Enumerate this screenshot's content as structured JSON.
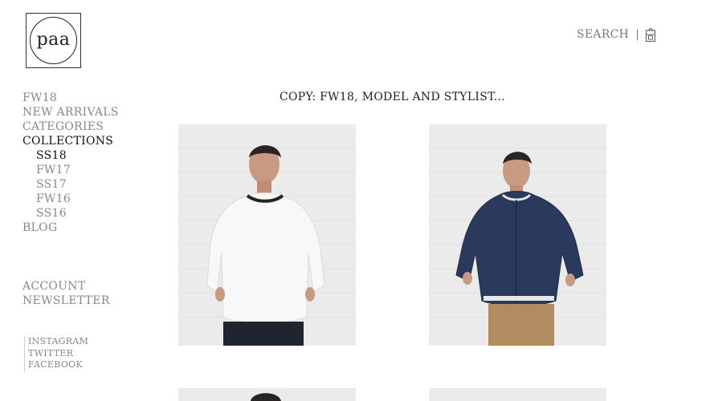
{
  "logo": {
    "text": "paa"
  },
  "header": {
    "search_label": "SEARCH",
    "separator": "|",
    "bag_icon": "shopping-bag-icon"
  },
  "nav": {
    "items": [
      {
        "label": "FW18"
      },
      {
        "label": "NEW ARRIVALS"
      },
      {
        "label": "CATEGORIES"
      },
      {
        "label": "COLLECTIONS"
      }
    ],
    "collections": [
      {
        "label": "SS18"
      },
      {
        "label": "FW17"
      },
      {
        "label": "SS17"
      },
      {
        "label": "FW16"
      },
      {
        "label": "SS16"
      }
    ],
    "blog": "BLOG",
    "account": "ACCOUNT",
    "newsletter": "NEWSLETTER"
  },
  "social": {
    "instagram": "INSTAGRAM",
    "twitter": "TWITTER",
    "facebook": "FACEBOOK"
  },
  "main": {
    "heading": "COPY: FW18, MODEL AND STYLIST...",
    "products": [
      {
        "name": "white-pullover-photo"
      },
      {
        "name": "navy-bomber-jacket-photo"
      }
    ]
  },
  "colors": {
    "text_muted": "#888888",
    "text_active": "#111111",
    "wall": "#ececec",
    "navy_jacket": "#2a3a5c",
    "white_top": "#f7f7f7"
  }
}
